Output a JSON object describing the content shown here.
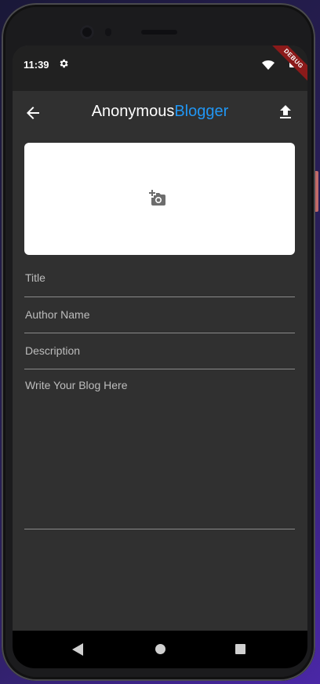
{
  "status_bar": {
    "time": "11:39",
    "icons": [
      "settings-icon",
      "wifi-icon",
      "battery-icon"
    ],
    "debug_banner": "DEBUG"
  },
  "app_bar": {
    "title_part1": "Anonymous",
    "title_part2": "Blogger",
    "title_part2_color": "#2196F3",
    "back_icon": "arrow-back-icon",
    "action_icon": "upload-icon"
  },
  "image_picker": {
    "icon": "add-a-photo-icon"
  },
  "form": {
    "title_placeholder": "Title",
    "author_placeholder": "Author Name",
    "description_placeholder": "Description",
    "content_placeholder": "Write Your Blog Here"
  },
  "nav_bar": {
    "icons": [
      "nav-back-icon",
      "nav-home-icon",
      "nav-recents-icon"
    ]
  },
  "colors": {
    "screen_background": "#303030",
    "status_bar_background": "#212121",
    "accent": "#2196F3"
  }
}
